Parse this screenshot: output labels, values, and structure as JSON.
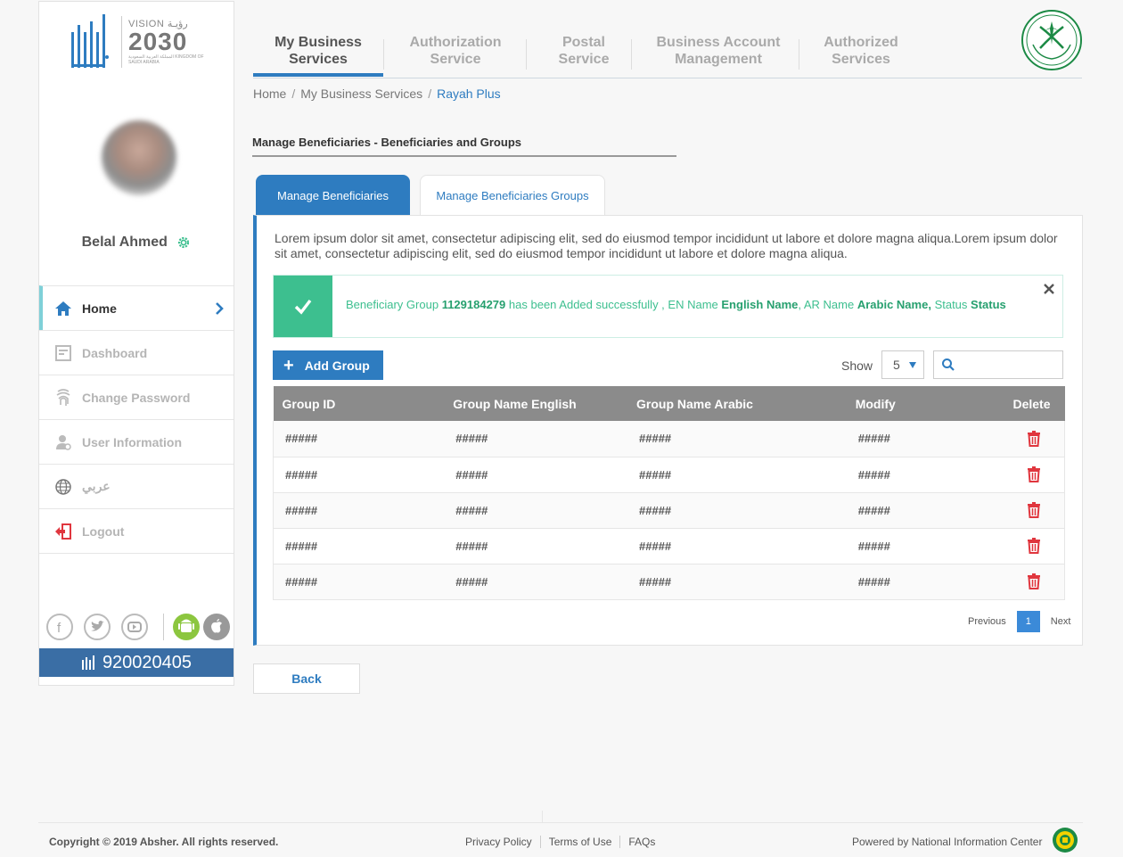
{
  "sidebar": {
    "logo_top": "VISION رؤيـة",
    "logo_year": "2030",
    "logo_sub": "المملكة العربية السعودية KINGDOM OF SAUDI ARABIA",
    "user_name": "Belal Ahmed",
    "items": [
      {
        "label": "Home",
        "icon": "home-icon"
      },
      {
        "label": "Dashboard",
        "icon": "dashboard-icon"
      },
      {
        "label": "Change Password",
        "icon": "fingerprint-icon"
      },
      {
        "label": "User Information",
        "icon": "user-icon"
      },
      {
        "label": "عربي",
        "icon": "globe-icon"
      },
      {
        "label": "Logout",
        "icon": "logout-icon"
      }
    ],
    "phone": "920020405"
  },
  "topnav": {
    "items": [
      {
        "line1": "My Business",
        "line2": "Services"
      },
      {
        "line1": "Authorization",
        "line2": "Service"
      },
      {
        "line1": "Postal",
        "line2": "Service"
      },
      {
        "line1": "Business Account",
        "line2": "Management"
      },
      {
        "line1": "Authorized",
        "line2": "Services"
      }
    ]
  },
  "breadcrumb": {
    "home": "Home",
    "section": "My Business Services",
    "current": "Rayah Plus"
  },
  "page_title": "Manage Beneficiaries - Beneficiaries and Groups",
  "tabs": {
    "tab1": "Manage Beneficiaries",
    "tab2": "Manage Beneficiaries Groups"
  },
  "description": "Lorem ipsum dolor sit amet, consectetur adipiscing elit, sed do eiusmod tempor incididunt ut labore et dolore magna aliqua.Lorem ipsum dolor sit amet, consectetur adipiscing elit, sed do eiusmod tempor incididunt ut labore et dolore magna aliqua.",
  "alert": {
    "prefix": "Beneficiary Group",
    "group_id": "1129184279",
    "middle": "has been Added successfully , EN Name",
    "en_name": "English Name",
    "ar_label": ", AR Name",
    "ar_name": "Arabic Name,",
    "status_label": "Status",
    "status": "Status"
  },
  "toolbar": {
    "add_label": "Add Group",
    "show_label": "Show",
    "show_value": "5",
    "search_placeholder": ""
  },
  "table": {
    "headers": {
      "id": "Group ID",
      "en": "Group Name English",
      "ar": "Group Name Arabic",
      "modify": "Modify",
      "delete": "Delete"
    },
    "rows": [
      {
        "id": "#####",
        "en": "#####",
        "ar": "#####",
        "modify": "#####"
      },
      {
        "id": "#####",
        "en": "#####",
        "ar": "#####",
        "modify": "#####"
      },
      {
        "id": "#####",
        "en": "#####",
        "ar": "#####",
        "modify": "#####"
      },
      {
        "id": "#####",
        "en": "#####",
        "ar": "#####",
        "modify": "#####"
      },
      {
        "id": "#####",
        "en": "#####",
        "ar": "#####",
        "modify": "#####"
      }
    ]
  },
  "pagination": {
    "previous": "Previous",
    "page": "1",
    "next": "Next"
  },
  "back_label": "Back",
  "footer": {
    "copyright": "Copyright © 2019 Absher. All rights reserved.",
    "links": [
      "Privacy Policy",
      "Terms of Use",
      "FAQs"
    ],
    "powered": "Powered by National Information Center"
  },
  "colors": {
    "accent": "#2e7cc0",
    "success": "#3dbf8f",
    "danger": "#e0363e",
    "table_header": "#8b8b8b"
  }
}
